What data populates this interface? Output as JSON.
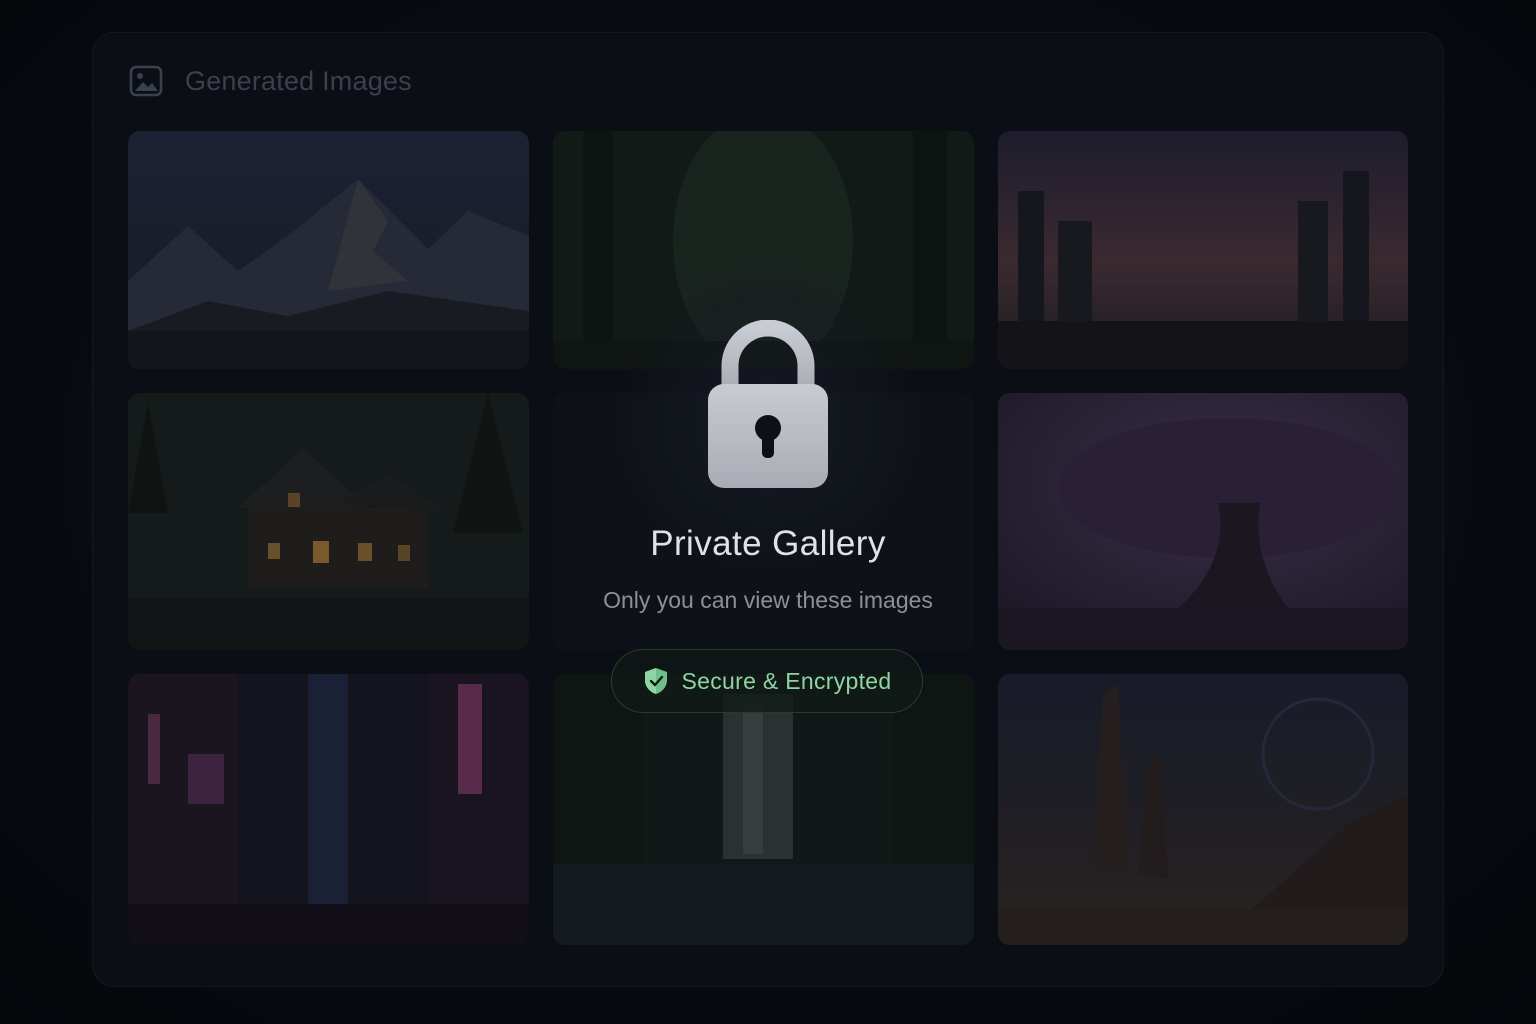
{
  "gallery": {
    "title": "Generated Images",
    "header_icon": "image-icon",
    "tiles": [
      {
        "name": "mountain-landscape-thumbnail"
      },
      {
        "name": "forest-path-thumbnail"
      },
      {
        "name": "city-sunset-thumbnail"
      },
      {
        "name": "forest-cabin-thumbnail"
      },
      {
        "name": "hidden-thumbnail"
      },
      {
        "name": "purple-tree-thumbnail"
      },
      {
        "name": "neon-street-thumbnail"
      },
      {
        "name": "waterfall-thumbnail"
      },
      {
        "name": "desert-rock-thumbnail"
      }
    ]
  },
  "lock_overlay": {
    "icon": "lock-icon",
    "title": "Private Gallery",
    "subtitle": "Only you can view these images",
    "badge": {
      "icon": "shield-check-icon",
      "label": "Secure & Encrypted",
      "color": "#8ed4a4"
    }
  },
  "colors": {
    "background": "#070a10",
    "panel": "#0b0e15",
    "accent_green": "#8ed4a4"
  }
}
